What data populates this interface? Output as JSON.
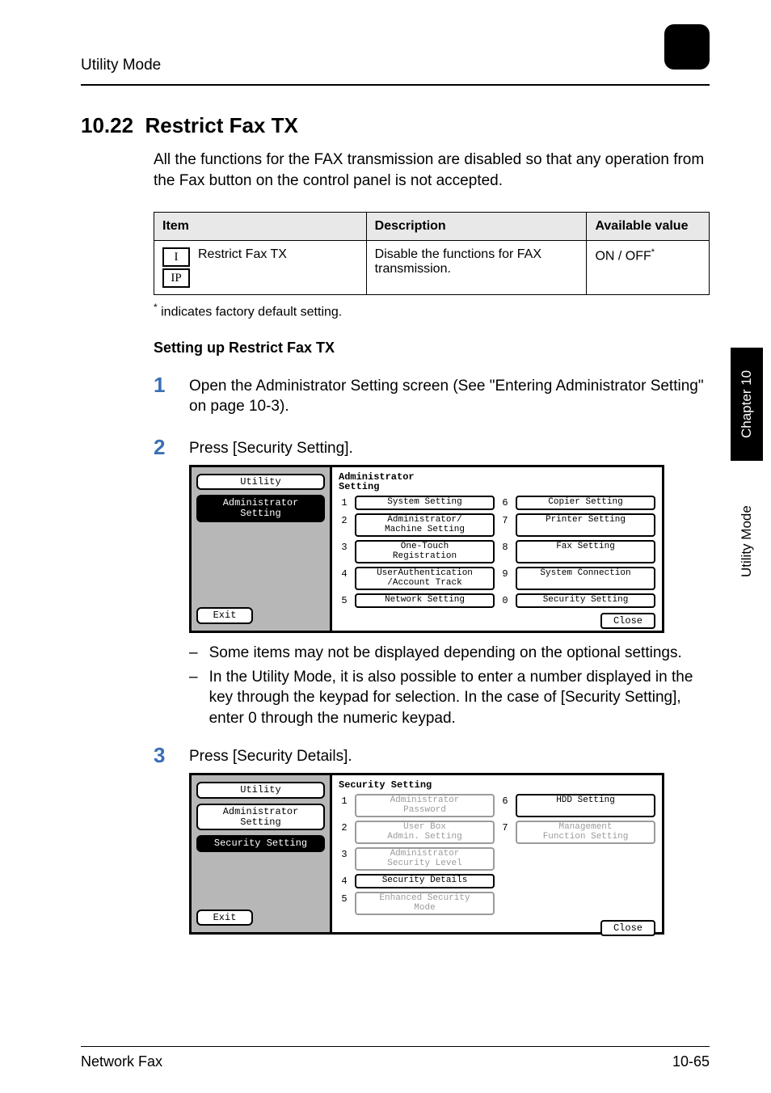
{
  "header": {
    "breadcrumb": "Utility Mode",
    "chapter_number": "10"
  },
  "section": {
    "number": "10.22",
    "title": "Restrict Fax TX",
    "intro": "All the functions for the FAX transmission are disabled so that any operation from the Fax button on the control panel is not accepted."
  },
  "table": {
    "headers": {
      "item": "Item",
      "description": "Description",
      "value": "Available value"
    },
    "row": {
      "icons": [
        "I",
        "IP"
      ],
      "name": "Restrict Fax TX",
      "description": "Disable the functions for FAX transmission.",
      "value": "ON / OFF",
      "value_marker": "*"
    },
    "footnote_marker": "*",
    "footnote": " indicates factory default setting."
  },
  "setup_heading": "Setting up Restrict Fax TX",
  "steps": {
    "s1": {
      "num": "1",
      "text": "Open the Administrator Setting screen (See \"Entering Administrator Setting\" on page 10-3)."
    },
    "s2": {
      "num": "2",
      "text": "Press [Security Setting]."
    },
    "s3": {
      "num": "3",
      "text": "Press [Security Details]."
    }
  },
  "notes": {
    "n1": "Some items may not be displayed depending on the optional settings.",
    "n2": "In the Utility Mode, it is also possible to enter a number displayed in the key through the keypad for selection. In the case of [Security Setting], enter 0 through the numeric keypad."
  },
  "screen1": {
    "left": {
      "utility": "Utility",
      "selected": "Administrator\nSetting",
      "exit": "Exit"
    },
    "title": "Administrator\nSetting",
    "buttons": {
      "b1": "System Setting",
      "b2": "Administrator/\nMachine Setting",
      "b3": "One-Touch\nRegistration",
      "b4": "UserAuthentication\n/Account Track",
      "b5": "Network Setting",
      "b6": "Copier Setting",
      "b7": "Printer Setting",
      "b8": "Fax Setting",
      "b9": "System Connection",
      "b0": "Security Setting"
    },
    "close": "Close"
  },
  "screen2": {
    "left": {
      "utility": "Utility",
      "item1": "Administrator\nSetting",
      "selected": "Security Setting",
      "exit": "Exit"
    },
    "title": "Security Setting",
    "buttons": {
      "b1": "Administrator\nPassword",
      "b2": "User Box\nAdmin. Setting",
      "b3": "Administrator\nSecurity Level",
      "b4": "Security Details",
      "b5": "Enhanced Security\nMode",
      "b6": "HDD Setting",
      "b7": "Management\nFunction Setting"
    },
    "close": "Close"
  },
  "sidetab": {
    "dark": "Chapter 10",
    "light": "Utility Mode"
  },
  "footer": {
    "left": "Network Fax",
    "right": "10-65"
  }
}
